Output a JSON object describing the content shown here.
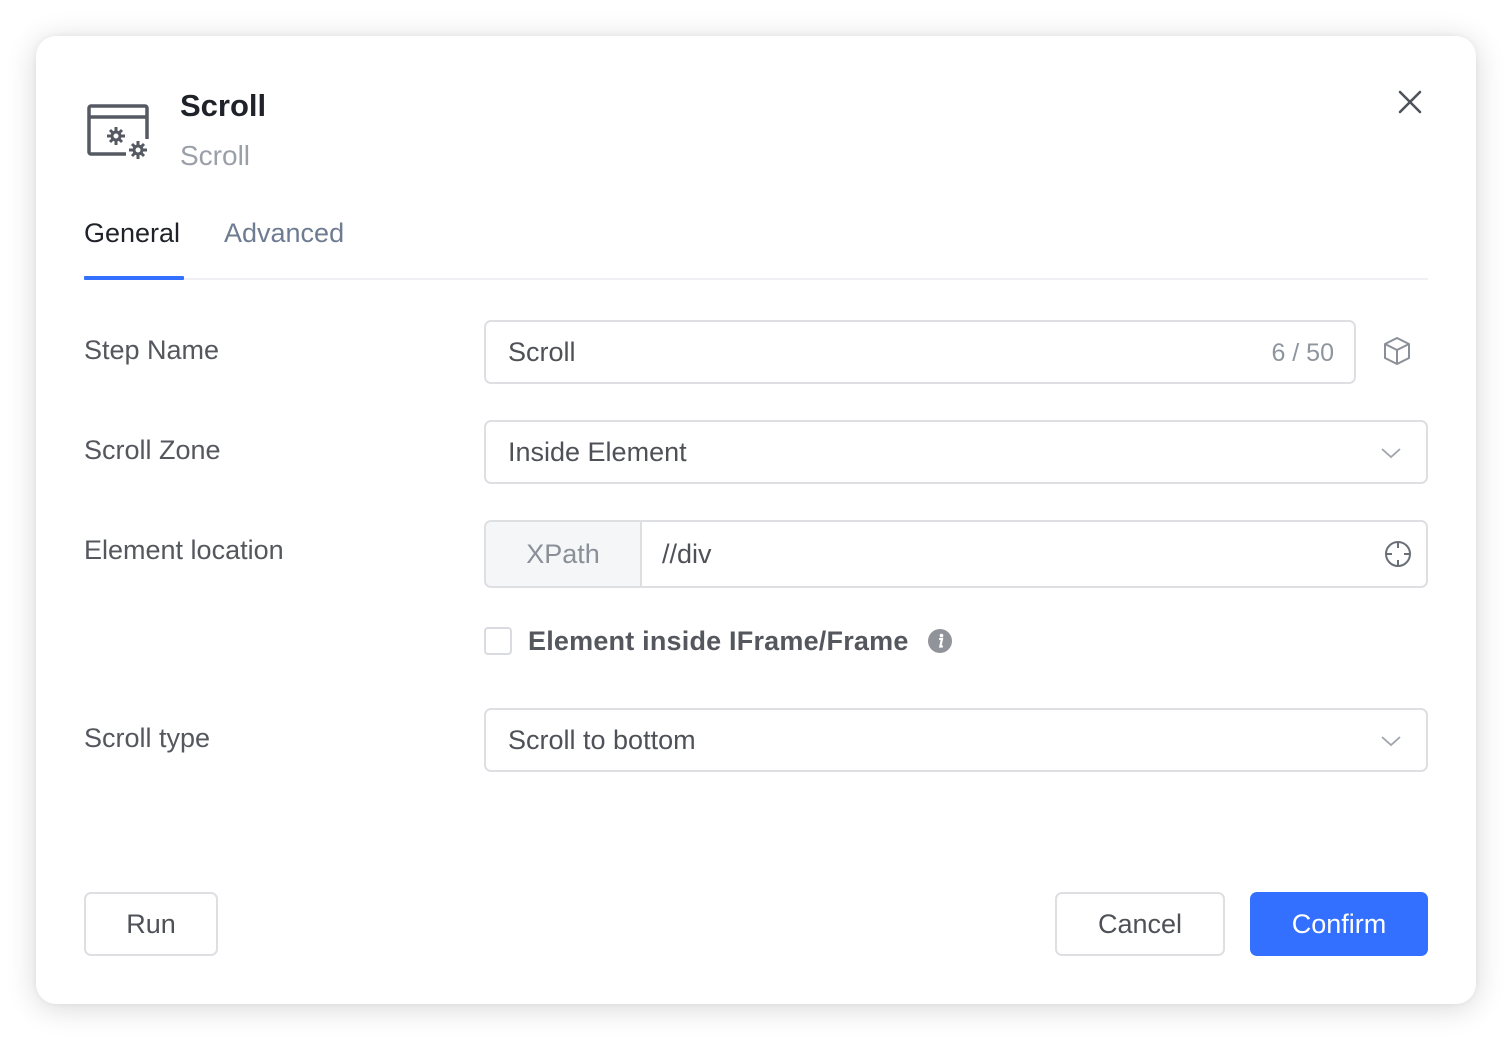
{
  "dialog": {
    "icon": "settings-window-icon",
    "title": "Scroll",
    "subtitle": "Scroll",
    "close_icon": "close-icon"
  },
  "tabs": [
    {
      "label": "General",
      "active": true
    },
    {
      "label": "Advanced",
      "active": false
    }
  ],
  "form": {
    "step_name": {
      "label": "Step Name",
      "value": "Scroll",
      "counter": "6 / 50",
      "side_icon": "cube-icon"
    },
    "scroll_zone": {
      "label": "Scroll Zone",
      "value": "Inside Element"
    },
    "element_location": {
      "label": "Element location",
      "prefix": "XPath",
      "value": "//div",
      "picker_icon": "crosshair-icon"
    },
    "iframe_checkbox": {
      "label": "Element inside IFrame/Frame",
      "checked": false,
      "info_icon": "info-icon"
    },
    "scroll_type": {
      "label": "Scroll type",
      "value": "Scroll to bottom"
    }
  },
  "footer": {
    "run_label": "Run",
    "cancel_label": "Cancel",
    "confirm_label": "Confirm"
  },
  "colors": {
    "accent": "#3370ff",
    "title": "#1f2329",
    "muted": "#9ba0a8",
    "border": "#dedfe3"
  }
}
